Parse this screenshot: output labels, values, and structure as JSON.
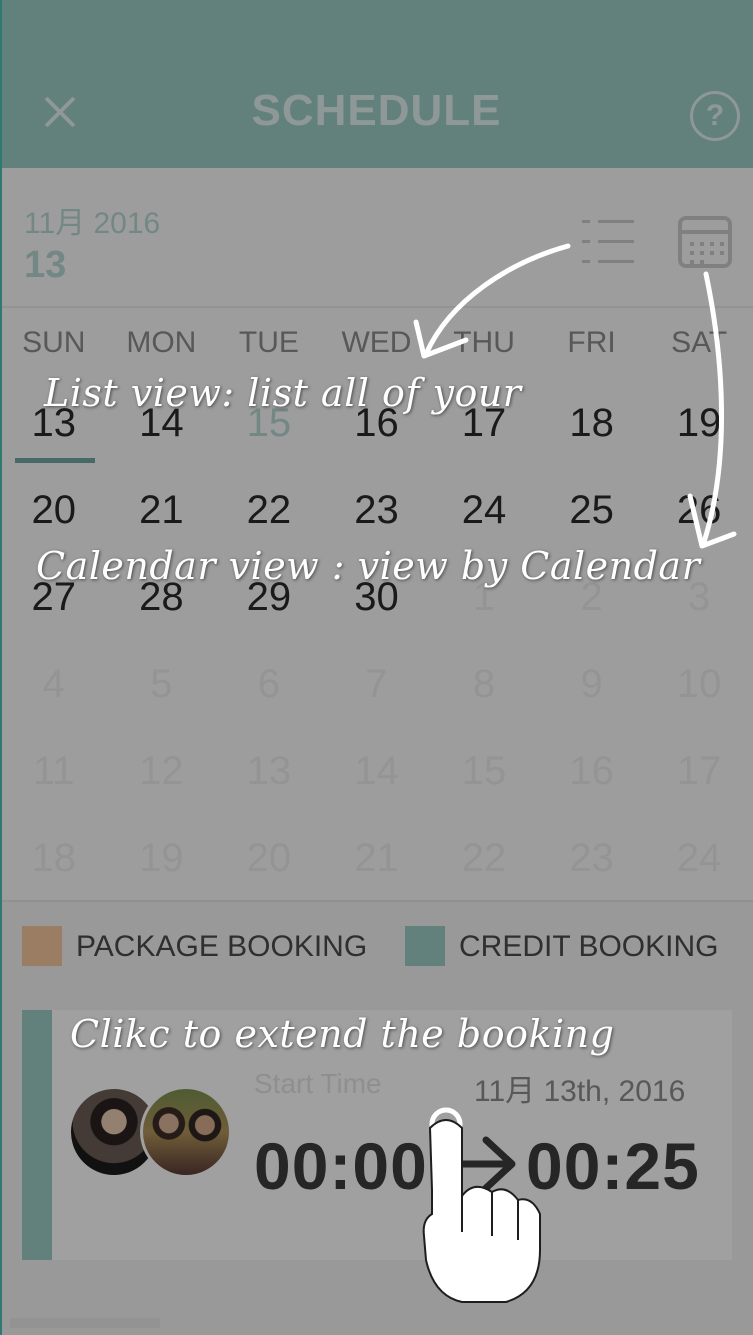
{
  "header": {
    "title": "SCHEDULE",
    "help_label": "?"
  },
  "monthbar": {
    "month": "11月 2016",
    "day": "13"
  },
  "calendar": {
    "weekdays": [
      "SUN",
      "MON",
      "TUE",
      "WED",
      "THU",
      "FRI",
      "SAT"
    ],
    "rows": [
      [
        "13",
        "14",
        "15",
        "16",
        "17",
        "18",
        "19"
      ],
      [
        "20",
        "21",
        "22",
        "23",
        "24",
        "25",
        "26"
      ],
      [
        "27",
        "28",
        "29",
        "30",
        "1",
        "2",
        "3"
      ],
      [
        "4",
        "5",
        "6",
        "7",
        "8",
        "9",
        "10"
      ],
      [
        "11",
        "12",
        "13",
        "14",
        "15",
        "16",
        "17"
      ],
      [
        "18",
        "19",
        "20",
        "21",
        "22",
        "23",
        "24"
      ]
    ]
  },
  "legend": {
    "package": "PACKAGE BOOKING",
    "credit": "CREDIT BOOKING"
  },
  "booking": {
    "start_label": "Start Time",
    "date": "11月 13th, 2016",
    "start_time": "00:00",
    "end_time": "00:25"
  },
  "tutorial": {
    "list_view": "List view: list all of  your",
    "calendar_view": "Calendar view : view by Calendar",
    "extend": "Clikc to extend the  booking"
  },
  "colors": {
    "accent_teal": "#9ac8c2",
    "package_swatch": "#f2c49b",
    "credit_swatch": "#9ac8c2"
  }
}
